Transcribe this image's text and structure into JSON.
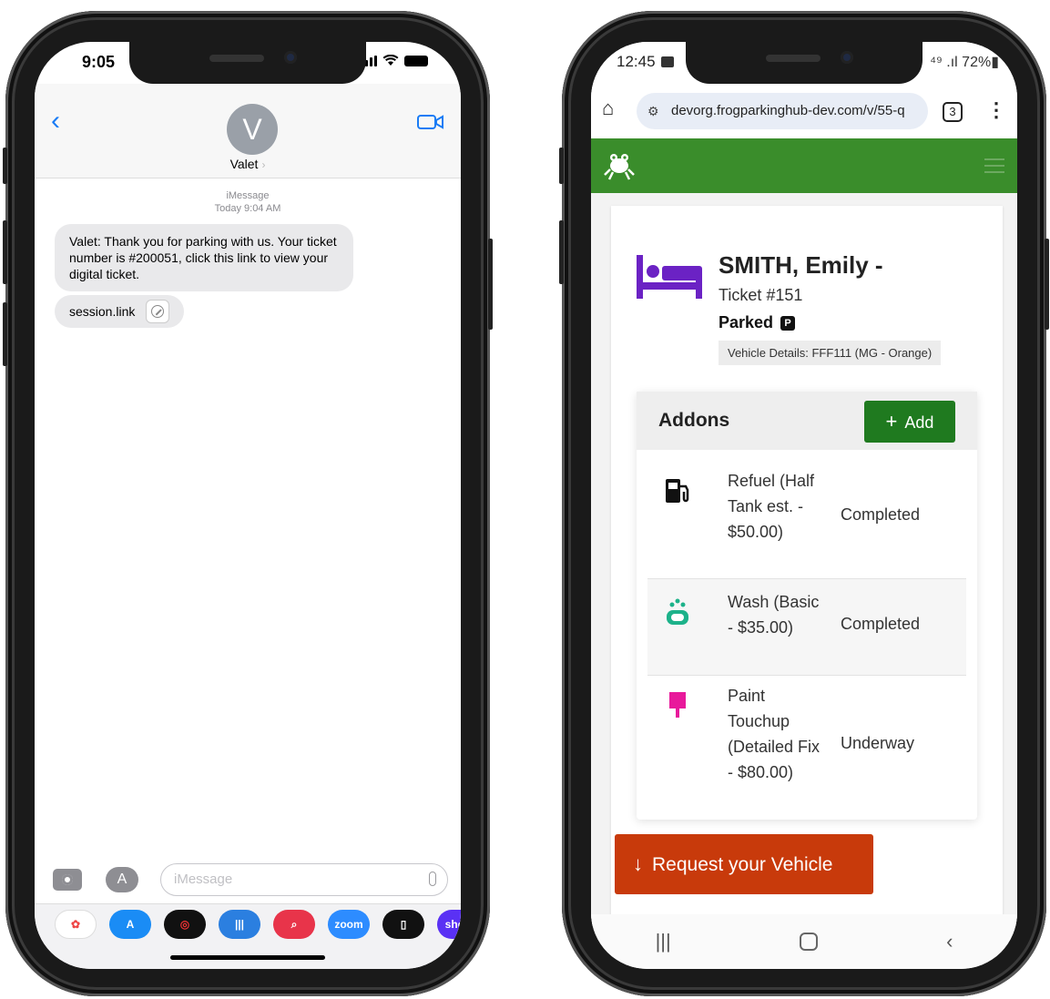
{
  "left_phone": {
    "status_time": "9:05",
    "contact": {
      "initial": "V",
      "name": "Valet"
    },
    "meta": {
      "service": "iMessage",
      "timestamp": "Today 9:04 AM"
    },
    "messages": [
      {
        "text": "Valet: Thank you for parking with us. Your ticket number is #200051, click this link to view your digital ticket."
      },
      {
        "text": "session.link"
      }
    ],
    "input_placeholder": "iMessage",
    "dock_apps": [
      "Photos",
      "App Store",
      "Fitness",
      "Voice Memos",
      "Search",
      "zoom",
      "Files",
      "shop"
    ]
  },
  "right_phone": {
    "status_time": "12:45",
    "status_right": "⁴⁹ .ıl 72%▮",
    "url": "devorg.frogparkinghub-dev.com/v/55-q",
    "tab_count": "3",
    "colors": {
      "brand_green": "#3a8d2b",
      "add_green": "#1f7a1f",
      "request_red": "#c83a0b",
      "bed_purple": "#6b22c4"
    },
    "guest": {
      "name": "SMITH, Emily -",
      "ticket": "Ticket #151",
      "status": "Parked",
      "status_badge": "P",
      "vehicle": "Vehicle Details: FFF111 (MG - Orange)"
    },
    "addons": {
      "title": "Addons",
      "add_label": "Add",
      "items": [
        {
          "icon": "fuel-pump-icon",
          "name": "Refuel (Half Tank est. - $50.00)",
          "status": "Completed"
        },
        {
          "icon": "soap-icon",
          "name": "Wash (Basic - $35.00)",
          "status": "Completed"
        },
        {
          "icon": "paint-brush-icon",
          "name": "Paint Touchup (Detailed Fix - $80.00)",
          "status": "Underway"
        }
      ]
    },
    "request_label": "Request your Vehicle"
  }
}
